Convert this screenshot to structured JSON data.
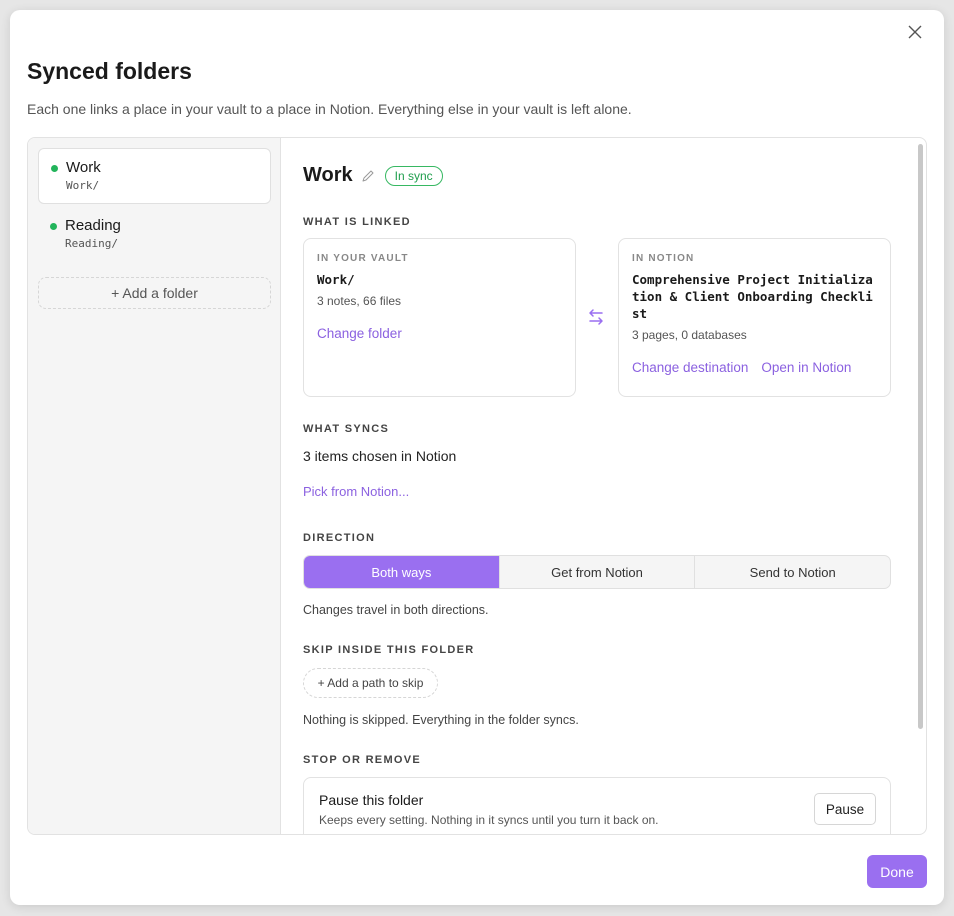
{
  "dialog": {
    "title": "Synced folders",
    "description": "Each one links a place in your vault to a place in Notion. Everything else in your vault is left alone."
  },
  "sidebar": {
    "items": [
      {
        "name": "Work",
        "path": "Work/",
        "status_color": "#22b45b",
        "active": true
      },
      {
        "name": "Reading",
        "path": "Reading/",
        "status_color": "#22b45b",
        "active": false
      }
    ],
    "add_folder_label": "+ Add a folder"
  },
  "detail": {
    "title": "Work",
    "badge": "In sync",
    "linked": {
      "label": "WHAT IS LINKED",
      "vault": {
        "label": "IN YOUR VAULT",
        "value": "Work/",
        "meta": "3 notes, 66 files",
        "change_label": "Change folder"
      },
      "notion": {
        "label": "IN NOTION",
        "value": "Comprehensive Project Initialization & Client Onboarding Checklist",
        "meta": "3 pages, 0 databases",
        "change_label": "Change destination",
        "open_label": "Open in Notion"
      }
    },
    "syncs": {
      "label": "WHAT SYNCS",
      "summary": "3 items chosen in Notion",
      "pick_label": "Pick from Notion..."
    },
    "direction": {
      "label": "DIRECTION",
      "options": [
        "Both ways",
        "Get from Notion",
        "Send to Notion"
      ],
      "selected": "Both ways",
      "note": "Changes travel in both directions."
    },
    "skip": {
      "label": "SKIP INSIDE THIS FOLDER",
      "add_label": "+ Add a path to skip",
      "note": "Nothing is skipped. Everything in the folder syncs."
    },
    "stop": {
      "label": "STOP OR REMOVE",
      "pause_title": "Pause this folder",
      "pause_desc": "Keeps every setting. Nothing in it syncs until you turn it back on.",
      "pause_button": "Pause"
    }
  },
  "footer": {
    "done_label": "Done"
  },
  "colors": {
    "accent": "#9a6ff0",
    "link": "#8b61e0",
    "success": "#22b45b"
  }
}
